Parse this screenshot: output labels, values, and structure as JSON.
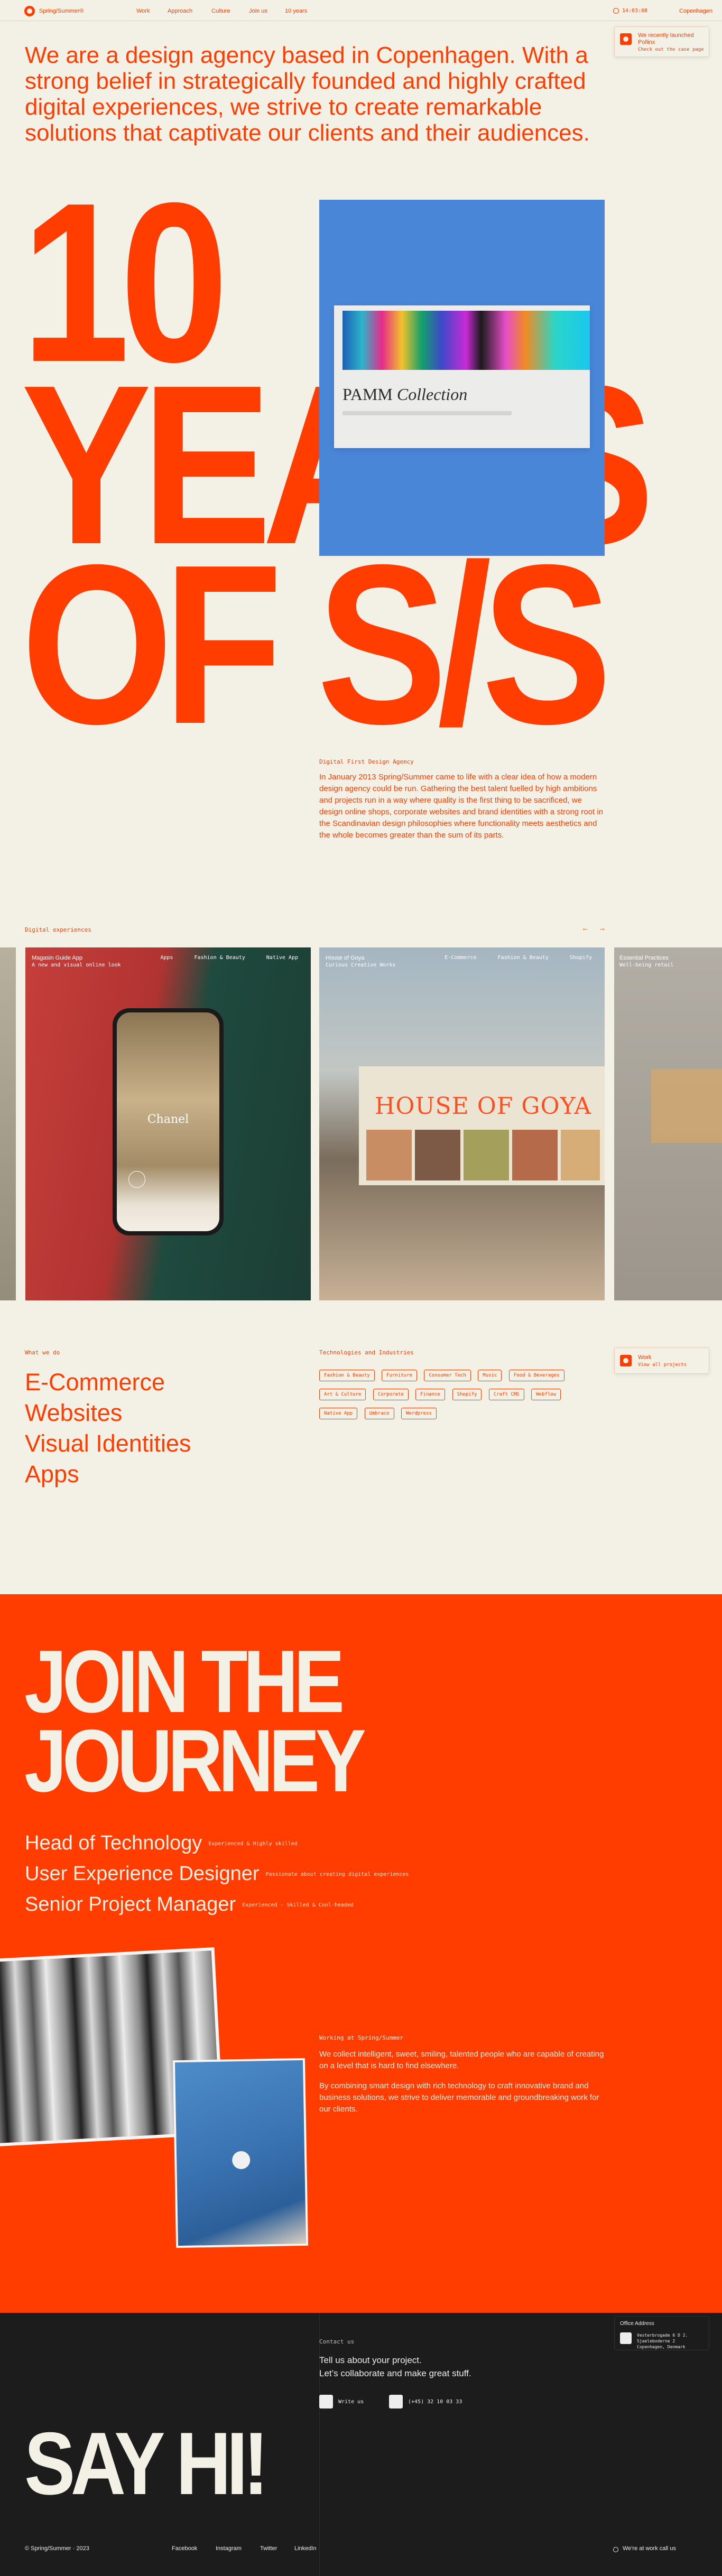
{
  "header": {
    "brand": "Spring/Summer®",
    "nav": [
      "Work",
      "Approach",
      "Culture",
      "Join us",
      "10 years"
    ],
    "time": "14:03:08",
    "city": "Copenhagen"
  },
  "news": {
    "title": "We recently launched",
    "subtitle": "Pollinx",
    "cta": "Check out the case page"
  },
  "intro": "We are a design agency based in Copenhagen. With a strong belief in strategically founded and highly crafted digital experiences, we strive to create remarkable solutions that captivate our clients and their audiences.",
  "hero": {
    "line1": "10",
    "line2": "YEARS",
    "line3": "OF S/S"
  },
  "featured_project": {
    "title": "PAMM",
    "title_italic": "Collection"
  },
  "about": {
    "label": "Digital First Design Agency",
    "text": "In January 2013 Spring/Summer came to life with a clear idea of how a modern design agency could be run. Gathering the best talent fuelled by high ambitions and projects run in a way where quality is the first thing to be sacrificed, we design online shops, corporate websites and brand identities with a strong root in the Scandinavian design philosophies where functionality meets aesthetics and the whole becomes greater than the sum of its parts."
  },
  "experiences": {
    "label": "Digital experiences",
    "prev": "←",
    "next": "→",
    "slides": [
      {
        "title": "Magasin Guide App",
        "subtitle": "A new and visual online look",
        "tags": [
          "Apps",
          "Fashion & Beauty",
          "Native App"
        ],
        "app_title": "Chanel"
      },
      {
        "title": "House of Goya",
        "subtitle": "Curious Creative Works",
        "tags": [
          "E-Commerce",
          "Fashion & Beauty",
          "Shopify"
        ],
        "sign_title": "HOUSE OF GOYA"
      },
      {
        "title": "Essential Practices",
        "subtitle": "Well-being retail"
      }
    ]
  },
  "what_we_do": {
    "label": "What we do",
    "services": [
      "E-Commerce",
      "Websites",
      "Visual Identities",
      "Apps"
    ]
  },
  "technologies": {
    "label": "Technologies and Industries",
    "tags": [
      "Fashion & Beauty",
      "Furniture",
      "Consumer Tech",
      "Music",
      "Food & Beverages",
      "Art & Culture",
      "Corporate",
      "Finance",
      "Shopify",
      "Craft CMS",
      "Webflow",
      "Native App",
      "Umbraco",
      "Wordpress"
    ]
  },
  "work_card": {
    "title": "Work",
    "subtitle": "View all projects"
  },
  "join": {
    "title_line1": "JOIN THE",
    "title_line2": "JOURNEY",
    "jobs": [
      {
        "title": "Head of Technology",
        "note": "Experienced & Highly skilled"
      },
      {
        "title": "User Experience Designer",
        "note": "Passionate about creating digital experiences"
      },
      {
        "title": "Senior Project Manager",
        "note": "Experienced - Skilled & Cool-headed"
      }
    ],
    "label": "Working at Spring/Summer",
    "text1": "We collect intelligent, sweet, smiling, talented people who are capable of creating on a level that is hard to find elsewhere.",
    "text2": "By combining smart design with rich technology to craft innovative brand and business solutions, we strive to deliver memorable and groundbreaking work for our clients."
  },
  "contact": {
    "label": "Contact us",
    "line1": "Tell us about your project.",
    "line2": "Let’s collaborate and make great stuff.",
    "write": "Write us",
    "phone": "(+45) 32 10 03 33",
    "say_hi": "SAY HI!"
  },
  "office": {
    "title": "Office Address",
    "line1": "Vesterbrogade 6 D 2.",
    "line2": "Sjaeleboderne 2",
    "line3": "Copenhagen, Denmark"
  },
  "footer": {
    "copyright": "© Spring/Summer · 2023",
    "links": [
      "Facebook",
      "Instagram",
      "Twitter",
      "LinkedIn"
    ],
    "status": "We're at work call us"
  },
  "colors": {
    "accent": "#ff3d00",
    "background": "#f3f0e6",
    "footer": "#1c1c1c",
    "project_blue": "#4a86d8"
  }
}
